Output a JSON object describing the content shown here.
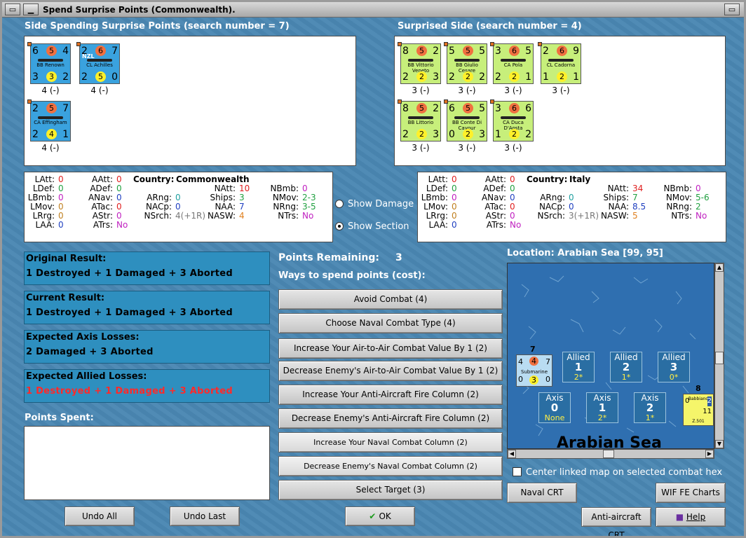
{
  "window": {
    "title": "Spend Surprise Points (Commonwealth)."
  },
  "left_section": {
    "label": "Side Spending Surprise Points (search number = 7)"
  },
  "right_section": {
    "label": "Surprised Side (search number = 4)"
  },
  "left_units": [
    {
      "name": "BB Renown",
      "tl": "6",
      "att": "5",
      "tr": "4",
      "bl": "3",
      "def": "3",
      "br": "2",
      "caption": "4 (-)",
      "nat": ""
    },
    {
      "name": "CL Achilles",
      "tl": "2",
      "att": "6",
      "tr": "7",
      "bl": "2",
      "def": "5",
      "br": "0",
      "caption": "4 (-)",
      "nat": "NZL"
    },
    {
      "name": "CA Effingham",
      "tl": "2",
      "att": "5",
      "tr": "7",
      "bl": "2",
      "def": "4",
      "br": "1",
      "caption": "4 (-)",
      "nat": ""
    }
  ],
  "right_units": [
    {
      "name": "BB Vittorio Veneto",
      "tl": "8",
      "att": "5",
      "tr": "2",
      "bl": "2",
      "def": "2",
      "br": "3",
      "caption": "3 (-)"
    },
    {
      "name": "BB Giulio Cesare",
      "tl": "5",
      "att": "5",
      "tr": "5",
      "bl": "2",
      "def": "2",
      "br": "2",
      "caption": "3 (-)"
    },
    {
      "name": "CA Pola",
      "tl": "3",
      "att": "6",
      "tr": "5",
      "bl": "2",
      "def": "2",
      "br": "1",
      "caption": "3 (-)"
    },
    {
      "name": "CL Cadorna",
      "tl": "2",
      "att": "6",
      "tr": "9",
      "bl": "1",
      "def": "2",
      "br": "1",
      "caption": "3 (-)"
    },
    {
      "name": "BB Littorio",
      "tl": "8",
      "att": "5",
      "tr": "2",
      "bl": "2",
      "def": "2",
      "br": "3",
      "caption": "3 (-)"
    },
    {
      "name": "BB Conte Di Cavour",
      "tl": "6",
      "att": "5",
      "tr": "5",
      "bl": "0",
      "def": "2",
      "br": "3",
      "caption": "3 (-)"
    },
    {
      "name": "CA Duca D'Aosta",
      "tl": "3",
      "att": "6",
      "tr": "6",
      "bl": "1",
      "def": "2",
      "br": "2",
      "caption": "3 (-)"
    }
  ],
  "left_stats": {
    "country_label": "Country:",
    "country": "Commonwealth",
    "latt": "0",
    "ldef": "0",
    "lbmb": "0",
    "lmov": "0",
    "lrng": "0",
    "laa": "0",
    "aatt": "0",
    "adef": "0",
    "anav": "0",
    "atac": "0",
    "astr": "0",
    "atrs": "No",
    "arng": "0",
    "nacp": "0",
    "nsrch": "4(+1R)",
    "natt": "10",
    "ships": "3",
    "naa": "7",
    "nasw": "4",
    "nbmb": "0",
    "nmov": "2-3",
    "nrng": "3-5",
    "ntrs": "No"
  },
  "right_stats": {
    "country_label": "Country:",
    "country": "Italy",
    "latt": "0",
    "ldef": "0",
    "lbmb": "0",
    "lmov": "0",
    "lrng": "0",
    "laa": "0",
    "aatt": "0",
    "adef": "0",
    "anav": "0",
    "atac": "0",
    "astr": "0",
    "atrs": "No",
    "arng": "0",
    "nacp": "0",
    "nsrch": "3(+1R)",
    "natt": "34",
    "ships": "7",
    "naa": "8.5",
    "nasw": "5",
    "nbmb": "0",
    "nmov": "5-6",
    "nrng": "2",
    "ntrs": "No"
  },
  "stat_labels": {
    "latt": "LAtt:",
    "ldef": "LDef:",
    "lbmb": "LBmb:",
    "lmov": "LMov:",
    "lrng": "LRrg:",
    "laa": "LAA:",
    "aatt": "AAtt:",
    "adef": "ADef:",
    "anav": "ANav:",
    "atac": "ATac:",
    "astr": "AStr:",
    "atrs": "ATrs:",
    "arng": "ARng:",
    "nacp": "NACp:",
    "nsrch": "NSrch:",
    "natt": "NAtt:",
    "ships": "Ships:",
    "naa": "NAA:",
    "nasw": "NASW:",
    "nbmb": "NBmb:",
    "nmov": "NMov:",
    "nrng": "NRng:",
    "ntrs": "NTrs:"
  },
  "options": {
    "show_damage": "Show Damage",
    "show_section": "Show Section",
    "selected": "Show Section"
  },
  "results": [
    {
      "heading": "Original Result:",
      "value": "1 Destroyed + 1 Damaged + 3 Aborted",
      "color": "#000000"
    },
    {
      "heading": "Current Result:",
      "value": "1 Destroyed + 1 Damaged + 3 Aborted",
      "color": "#000000"
    },
    {
      "heading": "Expected Axis Losses:",
      "value": "2 Damaged + 3 Aborted",
      "color": "#000000"
    },
    {
      "heading": "Expected Allied Losses:",
      "value": "1 Destroyed + 1 Damaged + 3 Aborted",
      "color": "#ff2a2a"
    }
  ],
  "points_spent_label": "Points Spent:",
  "points": {
    "label": "Points Remaining:",
    "value": "3",
    "ways_label": "Ways to spend points (cost):"
  },
  "spend_buttons": [
    "Avoid Combat (4)",
    "Choose Naval Combat Type (4)",
    "Increase Your Air-to-Air Combat Value By 1 (2)",
    "Decrease Enemy's Air-to-Air Combat Value By 1 (2)",
    "Increase Your Anti-Aircraft Fire Column (2)",
    "Decrease Enemy's Anti-Aircraft Fire Column (2)",
    "Increase Your Naval Combat Column (2)",
    "Decrease Enemy's Naval Combat Column (2)",
    "Select Target (3)"
  ],
  "location": {
    "label": "Location: Arabian Sea [99, 95]",
    "map_name": "Arabian Sea"
  },
  "map_boxes": {
    "allied": [
      {
        "title": "Allied",
        "num": "1",
        "sub": "2*"
      },
      {
        "title": "Allied",
        "num": "2",
        "sub": "1*"
      },
      {
        "title": "Allied",
        "num": "3",
        "sub": "0*"
      }
    ],
    "axis": [
      {
        "title": "Axis",
        "num": "0",
        "sub": "None"
      },
      {
        "title": "Axis",
        "num": "1",
        "sub": "2*"
      },
      {
        "title": "Axis",
        "num": "2",
        "sub": "1*"
      }
    ],
    "sub_unit": {
      "name": "Submarine",
      "stack": "7",
      "tl": "4",
      "att": "4",
      "tr": "7",
      "bl": "0",
      "def": "3",
      "br": "0"
    },
    "ital_unit": {
      "name": "Babbiano",
      "code": "Z.501",
      "stack": "8",
      "tl": "0",
      "tr": "2",
      "br": "11"
    }
  },
  "center_map": {
    "label": "Center linked map on selected combat hex"
  },
  "buttons": {
    "naval_crt": "Naval CRT",
    "wif_charts": "WIF FE Charts",
    "aa_crt": "Anti-aircraft CRT",
    "help": "Help",
    "undo_all": "Undo All",
    "undo_last": "Undo Last",
    "ok": "OK"
  }
}
